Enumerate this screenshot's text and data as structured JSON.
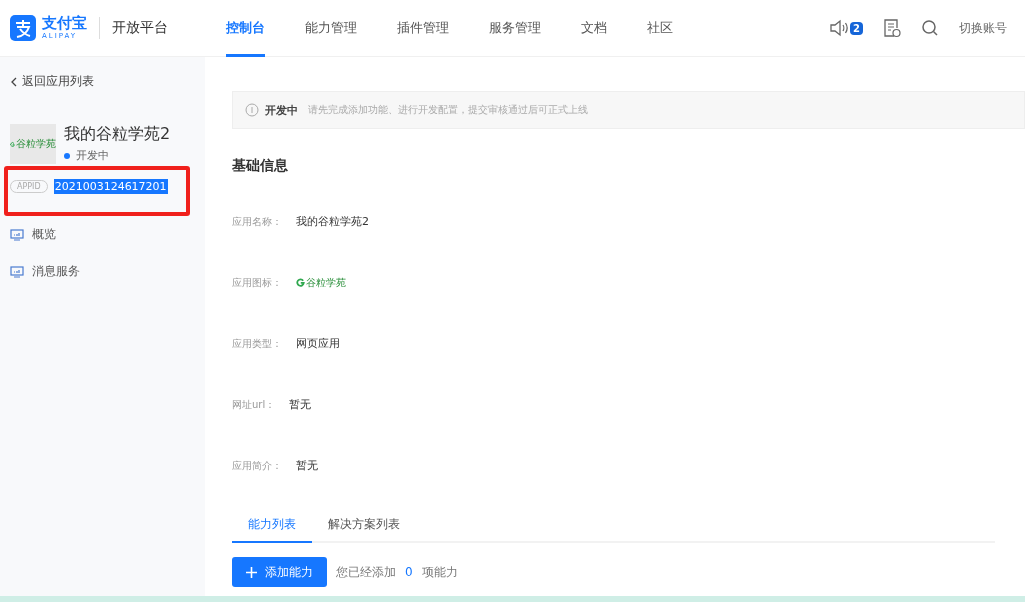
{
  "header": {
    "brand": "支付宝",
    "brand_sub": "ALIPAY",
    "platform": "开放平台",
    "nav": [
      {
        "label": "控制台",
        "selected": true
      },
      {
        "label": "能力管理",
        "selected": false
      },
      {
        "label": "插件管理",
        "selected": false
      },
      {
        "label": "服务管理",
        "selected": false
      },
      {
        "label": "文档",
        "selected": false
      },
      {
        "label": "社区",
        "selected": false
      }
    ],
    "notification_count": "2",
    "account": "切换账号"
  },
  "sidebar": {
    "back": "返回应用列表",
    "app_name": "我的谷粒学苑2",
    "app_logo_text": "谷粒学苑",
    "status": {
      "label": "开发中",
      "color": "#1677ff"
    },
    "appid_tag": "APPID",
    "appid": "2021003124617201",
    "items": [
      {
        "label": "概览",
        "selected": false
      },
      {
        "label": "消息服务",
        "selected": false
      }
    ]
  },
  "alert": {
    "title": "开发中",
    "message": "请先完成添加功能、进行开发配置，提交审核通过后可正式上线"
  },
  "basic_info": {
    "title": "基础信息",
    "fields": [
      {
        "kind": "text",
        "label": "应用名称：",
        "value": "我的谷粒学苑2"
      },
      {
        "kind": "logo",
        "label": "应用图标：",
        "value": "谷粒学苑"
      },
      {
        "kind": "text",
        "label": "应用类型：",
        "value": "网页应用"
      },
      {
        "kind": "text",
        "label": "网址url：",
        "value": "暂无"
      },
      {
        "kind": "text",
        "label": "应用简介：",
        "value": "暂无"
      }
    ]
  },
  "tabs": [
    {
      "label": "能力列表",
      "selected": true
    },
    {
      "label": "解决方案列表",
      "selected": false
    }
  ],
  "add_button": "添加能力",
  "added": {
    "prefix": "您已经添加",
    "count": "0",
    "suffix": "项能力"
  }
}
